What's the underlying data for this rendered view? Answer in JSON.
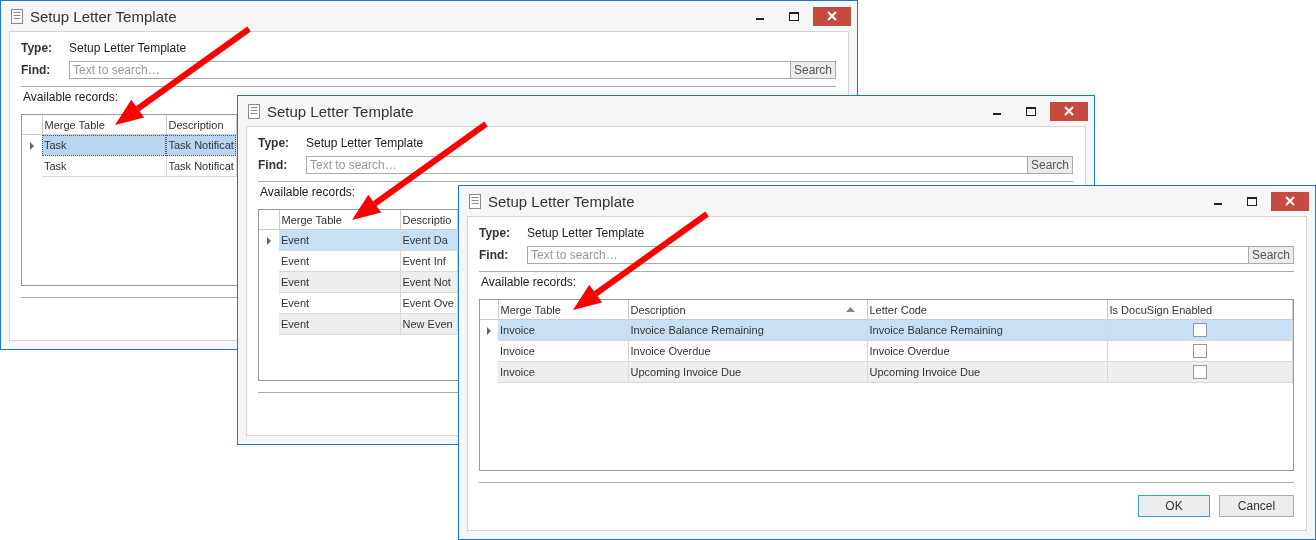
{
  "windows": [
    {
      "title": "Setup Letter Template",
      "type_label": "Type:",
      "type_value": "Setup Letter Template",
      "find_label": "Find:",
      "find_placeholder": "Text to search…",
      "search_button": "Search",
      "available_label": "Available records:",
      "grid_focused": true,
      "columns": [
        {
          "label": "Merge Table",
          "kind": "text"
        },
        {
          "label": "Description",
          "kind": "text"
        }
      ],
      "rows": [
        {
          "selected": true,
          "cells": [
            "Task",
            "Task Notificat"
          ]
        },
        {
          "selected": false,
          "cells": [
            "Task",
            "Task Notificat"
          ]
        }
      ]
    },
    {
      "title": "Setup Letter Template",
      "type_label": "Type:",
      "type_value": "Setup Letter Template",
      "find_label": "Find:",
      "find_placeholder": "Text to search…",
      "search_button": "Search",
      "available_label": "Available records:",
      "grid_focused": false,
      "columns": [
        {
          "label": "Merge Table",
          "kind": "text"
        },
        {
          "label": "Descriptio",
          "kind": "text"
        }
      ],
      "rows": [
        {
          "selected": true,
          "cells": [
            "Event",
            "Event Da"
          ]
        },
        {
          "selected": false,
          "cells": [
            "Event",
            "Event Inf"
          ]
        },
        {
          "selected": false,
          "cells": [
            "Event",
            "Event Not"
          ]
        },
        {
          "selected": false,
          "cells": [
            "Event",
            "Event Ove"
          ]
        },
        {
          "selected": false,
          "cells": [
            "Event",
            "New Even"
          ]
        }
      ]
    },
    {
      "title": "Setup Letter Template",
      "type_label": "Type:",
      "type_value": "Setup Letter Template",
      "find_label": "Find:",
      "find_placeholder": "Text to search…",
      "search_button": "Search",
      "available_label": "Available records:",
      "grid_focused": false,
      "columns": [
        {
          "label": "Merge Table",
          "kind": "text"
        },
        {
          "label": "Description",
          "kind": "text",
          "sorted": true
        },
        {
          "label": "Letter Code",
          "kind": "text"
        },
        {
          "label": "Is DocuSign Enabled",
          "kind": "checkbox"
        }
      ],
      "rows": [
        {
          "selected": true,
          "cells": [
            "Invoice",
            "Invoice Balance Remaining",
            "Invoice Balance Remaining"
          ],
          "checked": false
        },
        {
          "selected": false,
          "cells": [
            "Invoice",
            "Invoice Overdue",
            "Invoice Overdue"
          ],
          "checked": false
        },
        {
          "selected": false,
          "cells": [
            "Invoice",
            "Upcoming Invoice Due",
            "Upcoming Invoice Due"
          ],
          "checked": false
        }
      ],
      "buttons": [
        {
          "label": "OK",
          "default": true
        },
        {
          "label": "Cancel",
          "default": false
        }
      ]
    }
  ]
}
